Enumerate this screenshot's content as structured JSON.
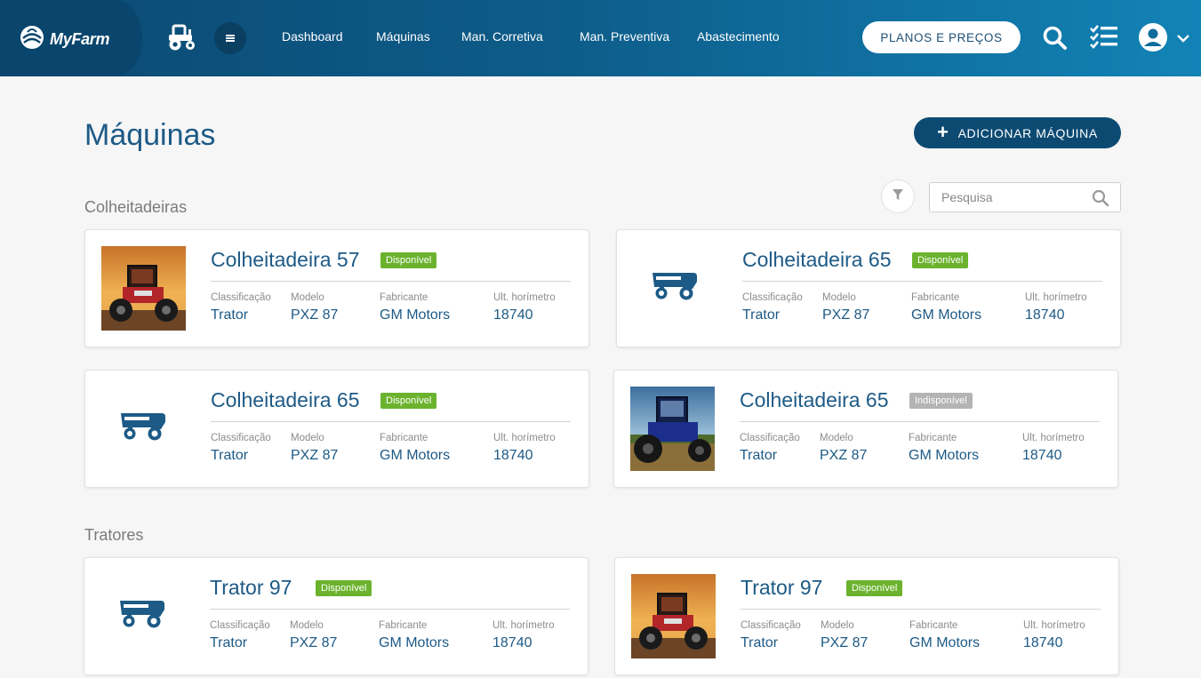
{
  "app": {
    "brand": "MyFarm"
  },
  "nav": [
    "Dashboard",
    "Máquinas",
    "Man. Corretiva",
    "Man. Preventiva",
    "Abastecimento"
  ],
  "header": {
    "plans_label": "PLANOS E PREÇOS"
  },
  "page": {
    "title": "Máquinas",
    "add_label": "ADICIONAR MÁQUINA",
    "search_placeholder": "Pesquisa"
  },
  "field_labels": {
    "class": "Classificação",
    "model": "Modelo",
    "maker": "Fabricante",
    "hours": "Ult. horímetro"
  },
  "sections": [
    {
      "title": "Colheitadeiras",
      "cards": [
        {
          "name": "Colheitadeira 57",
          "status": "Disponível",
          "available": true,
          "image": "red-tractor-photo",
          "classification": "Trator",
          "model": "PXZ 87",
          "maker": "GM Motors",
          "hours": "18740"
        },
        {
          "name": "Colheitadeira 65",
          "status": "Disponível",
          "available": true,
          "image": "harvester-icon",
          "classification": "Trator",
          "model": "PXZ 87",
          "maker": "GM Motors",
          "hours": "18740"
        },
        {
          "name": "Colheitadeira 65",
          "status": "Disponível",
          "available": true,
          "image": "harvester-icon",
          "classification": "Trator",
          "model": "PXZ 87",
          "maker": "GM Motors",
          "hours": "18740"
        },
        {
          "name": "Colheitadeira 65",
          "status": "Indisponível",
          "available": false,
          "image": "blue-tractor-photo",
          "classification": "Trator",
          "model": "PXZ 87",
          "maker": "GM Motors",
          "hours": "18740"
        }
      ]
    },
    {
      "title": "Tratores",
      "cards": [
        {
          "name": "Trator 97",
          "status": "Disponível",
          "available": true,
          "image": "harvester-icon",
          "classification": "Trator",
          "model": "PXZ 87",
          "maker": "GM Motors",
          "hours": "18740"
        },
        {
          "name": "Trator 97",
          "status": "Disponível",
          "available": true,
          "image": "red-tractor-photo",
          "classification": "Trator",
          "model": "PXZ 87",
          "maker": "GM Motors",
          "hours": "18740"
        }
      ]
    }
  ],
  "colors": {
    "primary": "#1d5a86",
    "header": "#0d5b88",
    "available": "#6bb32e",
    "unavailable": "#b4b4b4"
  }
}
